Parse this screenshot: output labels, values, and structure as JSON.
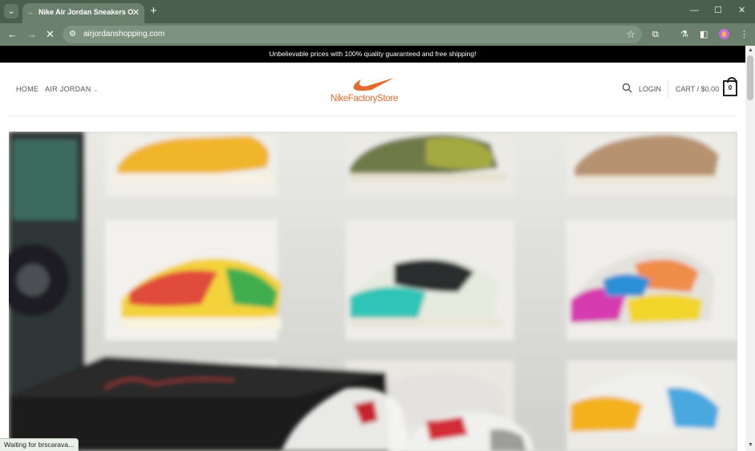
{
  "browser": {
    "tab_title": "Nike Air Jordan Sneakers Online",
    "url": "airjordanshopping.com",
    "status_text": "Waiting for brscarava..."
  },
  "page": {
    "announcement": "Unbelievable prices with 100% quality guaranteed and free shipping!",
    "nav": {
      "home": "HOME",
      "air_jordan": "AIR JORDAN"
    },
    "logo_text": "NikeFactoryStore",
    "login": "LOGIN",
    "cart_label": "CART / $0.00",
    "cart_count": "0"
  },
  "colors": {
    "brand_orange": "#e36b2e",
    "browser_frame": "#4a5f4c",
    "toolbar": "#6b816d",
    "announcement_bg": "#000000"
  }
}
